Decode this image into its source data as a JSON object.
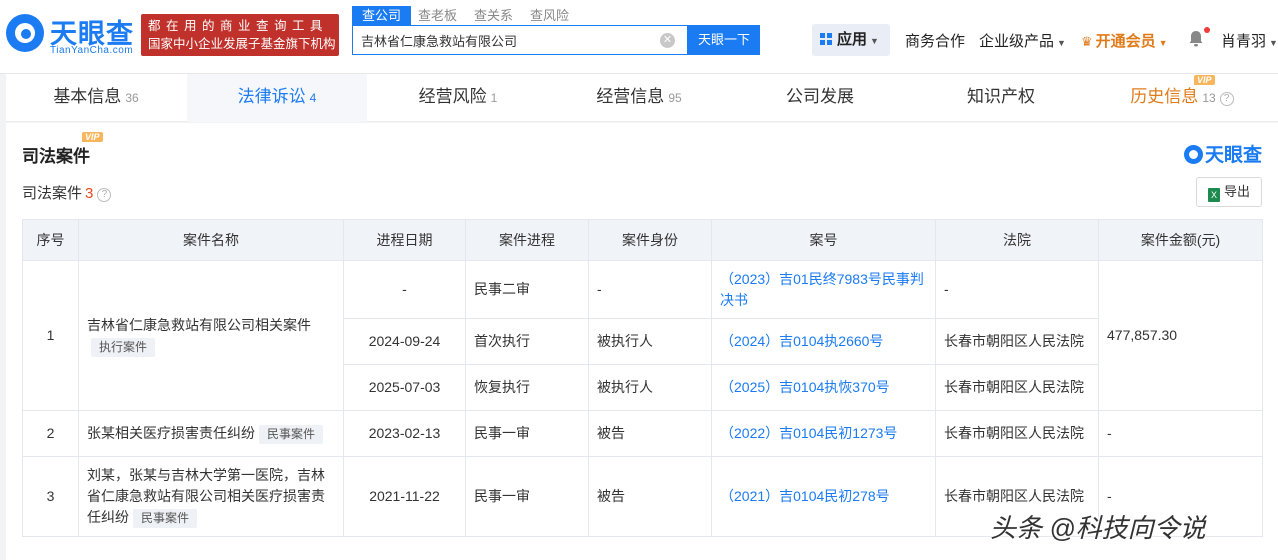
{
  "header": {
    "logo_cn": "天眼查",
    "logo_en": "TianYanCha.com",
    "promo_line1": "都在用的商业查询工具",
    "promo_line2": "国家中小企业发展子基金旗下机构",
    "search_tabs": [
      "查公司",
      "查老板",
      "查关系",
      "查风险"
    ],
    "search_value": "吉林省仁康急救站有限公司",
    "search_button": "天眼一下",
    "apps_label": "应用",
    "nav": [
      "商务合作",
      "企业级产品",
      "开通会员"
    ],
    "user_name": "肖青羽"
  },
  "tabs": [
    {
      "label": "基本信息",
      "count": "36"
    },
    {
      "label": "法律诉讼",
      "count": "4"
    },
    {
      "label": "经营风险",
      "count": "1"
    },
    {
      "label": "经营信息",
      "count": "95"
    },
    {
      "label": "公司发展",
      "count": ""
    },
    {
      "label": "知识产权",
      "count": ""
    },
    {
      "label": "历史信息",
      "count": "13"
    }
  ],
  "vip_label": "VIP",
  "section": {
    "title": "司法案件",
    "brand": "天眼查",
    "count_label": "司法案件",
    "count": "3",
    "export_label": "导出",
    "columns": [
      "序号",
      "案件名称",
      "进程日期",
      "案件进程",
      "案件身份",
      "案号",
      "法院",
      "案件金额(元)"
    ],
    "rows": [
      {
        "index": "1",
        "name": "吉林省仁康急救站有限公司相关案件",
        "tag": "执行案件",
        "amount": "477,857.30",
        "sub": [
          {
            "date": "-",
            "stage": "民事二审",
            "role": "-",
            "case_no": "（2023）吉01民终7983号民事判决书",
            "court": "-"
          },
          {
            "date": "2024-09-24",
            "stage": "首次执行",
            "role": "被执行人",
            "case_no": "（2024）吉0104执2660号",
            "court": "长春市朝阳区人民法院"
          },
          {
            "date": "2025-07-03",
            "stage": "恢复执行",
            "role": "被执行人",
            "case_no": "（2025）吉0104执恢370号",
            "court": "长春市朝阳区人民法院"
          }
        ]
      },
      {
        "index": "2",
        "name": "张某相关医疗损害责任纠纷",
        "tag": "民事案件",
        "amount": "-",
        "sub": [
          {
            "date": "2023-02-13",
            "stage": "民事一审",
            "role": "被告",
            "case_no": "（2022）吉0104民初1273号",
            "court": "长春市朝阳区人民法院"
          }
        ]
      },
      {
        "index": "3",
        "name": "刘某，张某与吉林大学第一医院，吉林省仁康急救站有限公司相关医疗损害责任纠纷",
        "tag": "民事案件",
        "amount": "-",
        "sub": [
          {
            "date": "2021-11-22",
            "stage": "民事一审",
            "role": "被告",
            "case_no": "（2021）吉0104民初278号",
            "court": "长春市朝阳区人民法院"
          }
        ]
      }
    ]
  },
  "watermark": "头条 @科技向令说"
}
